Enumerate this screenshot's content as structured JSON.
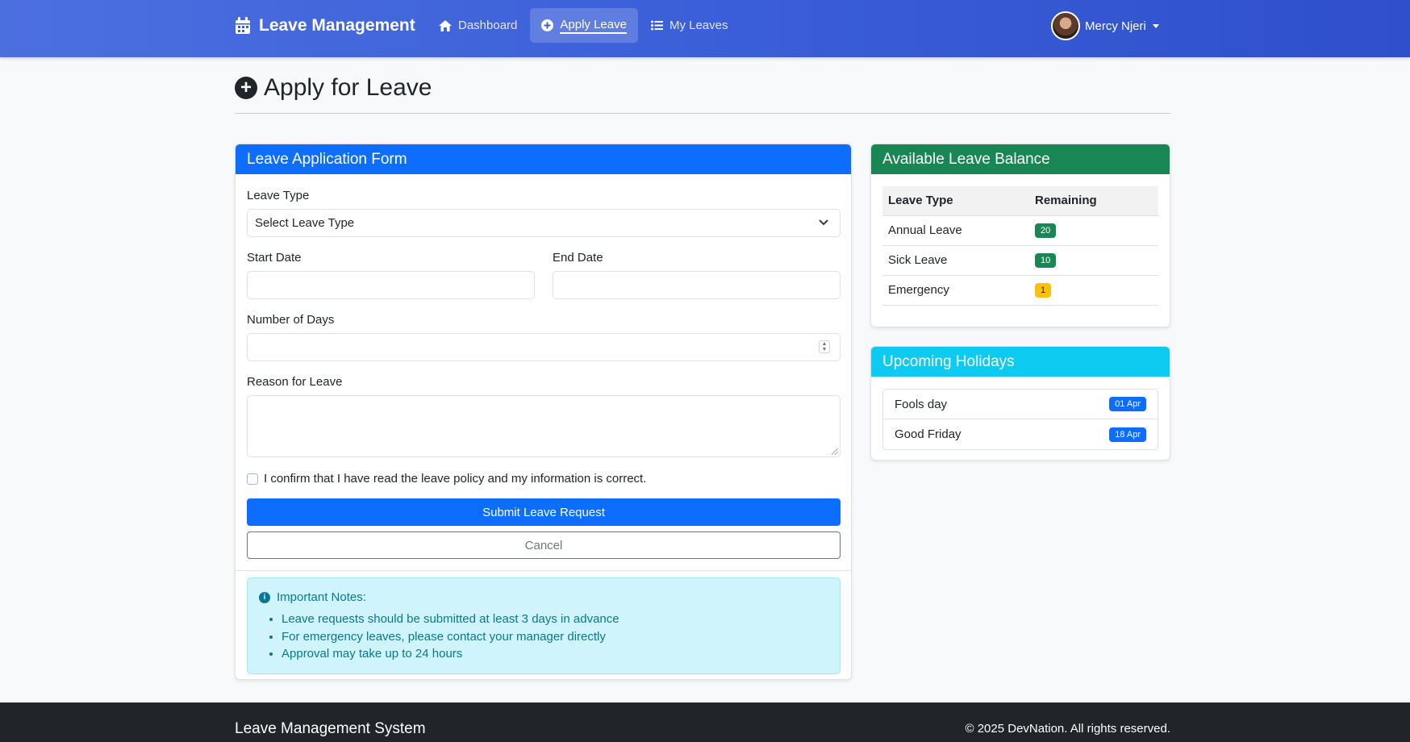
{
  "navbar": {
    "brand": "Leave Management",
    "links": [
      {
        "label": "Dashboard",
        "icon": "home-icon"
      },
      {
        "label": "Apply Leave",
        "icon": "plus-circle-icon",
        "active": true
      },
      {
        "label": "My Leaves",
        "icon": "list-icon"
      }
    ],
    "user_name": "Mercy Njeri"
  },
  "page": {
    "title": "Apply for Leave"
  },
  "form": {
    "header": "Leave Application Form",
    "leave_type_label": "Leave Type",
    "leave_type_value": "Select Leave Type",
    "start_date_label": "Start Date",
    "end_date_label": "End Date",
    "days_label": "Number of Days",
    "reason_label": "Reason for Leave",
    "confirm_label": "I confirm that I have read the leave policy and my information is correct.",
    "submit_label": "Submit Leave Request",
    "cancel_label": "Cancel"
  },
  "notes": {
    "title": "Important Notes:",
    "items": [
      "Leave requests should be submitted at least 3 days in advance",
      "For emergency leaves, please contact your manager directly",
      "Approval may take up to 24 hours"
    ]
  },
  "balance": {
    "header": "Available Leave Balance",
    "columns": [
      "Leave Type",
      "Remaining"
    ],
    "rows": [
      {
        "type": "Annual Leave",
        "remaining": "20",
        "color": "#198754"
      },
      {
        "type": "Sick Leave",
        "remaining": "10",
        "color": "#198754"
      },
      {
        "type": "Emergency",
        "remaining": "1",
        "color": "#ffc107"
      }
    ]
  },
  "holidays": {
    "header": "Upcoming Holidays",
    "items": [
      {
        "name": "Fools day",
        "date": "01 Apr"
      },
      {
        "name": "Good Friday",
        "date": "18 Apr"
      }
    ]
  },
  "footer": {
    "title": "Leave Management System",
    "copyright": "© 2025 DevNation. All rights reserved."
  },
  "colors": {
    "primary": "#0d6efd",
    "success": "#198754",
    "info": "#0dcaf0",
    "warning": "#ffc107",
    "navbar": "#3b5fd8"
  }
}
